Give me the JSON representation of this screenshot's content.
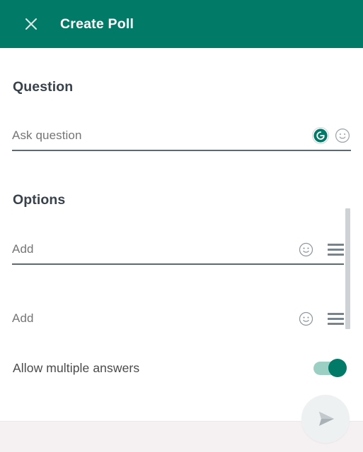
{
  "header": {
    "title": "Create Poll",
    "close_icon": "close-icon",
    "background_color": "#017a68",
    "title_color": "#ffffff"
  },
  "question_section": {
    "heading": "Question",
    "input": {
      "value": "",
      "placeholder": "Ask question"
    },
    "icons": [
      {
        "name": "grammarly-icon",
        "glyph": "G",
        "color": "#017a68"
      },
      {
        "name": "emoji-icon",
        "glyph": "smiley"
      }
    ]
  },
  "options_section": {
    "heading": "Options",
    "options": [
      {
        "input": {
          "value": "",
          "placeholder": "Add"
        },
        "icons": [
          {
            "name": "emoji-icon",
            "glyph": "smiley"
          },
          {
            "name": "drag-handle-icon",
            "glyph": "hamburger"
          }
        ]
      },
      {
        "input": {
          "value": "",
          "placeholder": "Add"
        },
        "icons": [
          {
            "name": "emoji-icon",
            "glyph": "smiley"
          },
          {
            "name": "drag-handle-icon",
            "glyph": "hamburger"
          }
        ]
      }
    ]
  },
  "settings": {
    "allow_multiple_answers": {
      "label": "Allow multiple answers",
      "state": "on",
      "accent_color": "#017a68",
      "track_color": "#9bcfc4"
    }
  },
  "footer": {
    "send_button": {
      "name": "send-button",
      "state": "disabled",
      "icon": "send-icon",
      "background_color": "#eef1f2",
      "icon_color": "#9aa5ab"
    },
    "background_color": "#f5f1f2"
  },
  "scrollbar": {
    "name": "vertical-scrollbar",
    "thumb_color": "#cfd2d4"
  }
}
